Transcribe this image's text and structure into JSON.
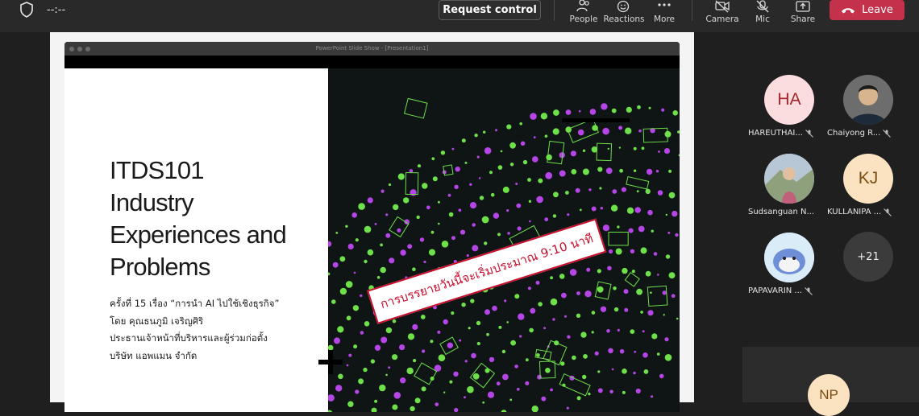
{
  "header": {
    "timer": "--:--",
    "request_control": "Request control",
    "buttons": [
      {
        "label": "People",
        "icon": "people-icon"
      },
      {
        "label": "Reactions",
        "icon": "reactions-icon"
      },
      {
        "label": "More",
        "icon": "more-icon"
      },
      {
        "label": "Camera",
        "icon": "camera-off-icon"
      },
      {
        "label": "Mic",
        "icon": "mic-off-icon"
      },
      {
        "label": "Share",
        "icon": "share-icon"
      }
    ],
    "leave": "Leave"
  },
  "presentation": {
    "window_title": "PowerPoint Slide Show - [Presentation1]",
    "slide_title_lines": [
      "ITDS101",
      "Industry",
      "Experiences and",
      "Problems"
    ],
    "subtitle_lines": [
      "ครั้งที่ 15 เรื่อง “การนำ AI ไปใช้เชิงธุรกิจ”",
      "โดย คุณธนภูมิ เจริญศิริ",
      "ประธานเจ้าหน้าที่บริหารและผู้ร่วมก่อตั้ง",
      "บริษัท แอพแมน จำกัด"
    ],
    "stamp": "การบรรยายวันนี้จะเริ่มประมาณ 9:10 นาที"
  },
  "participants": [
    {
      "initials": "HA",
      "name": "HAREUTHAI...",
      "muted": true,
      "avatar_bg": "#fbdcdf",
      "avatar_fg": "#a4262c"
    },
    {
      "initials": "",
      "name": "Chaiyong R...",
      "muted": true,
      "avatar_bg": "#4a4a4a",
      "avatar_fg": "#ffffff"
    },
    {
      "initials": "",
      "name": "Sudsanguan N...",
      "muted": false,
      "avatar_bg": "#9db3c9",
      "avatar_fg": "#ffffff"
    },
    {
      "initials": "KJ",
      "name": "KULLANIPA ...",
      "muted": true,
      "avatar_bg": "#fbe3c2",
      "avatar_fg": "#7a4d14"
    },
    {
      "initials": "",
      "name": "PAPAVARIN ...",
      "muted": true,
      "avatar_bg": "#cfe7f7",
      "avatar_fg": "#ffffff"
    }
  ],
  "more_count": "+21",
  "featured": {
    "initials": "NP"
  },
  "colors": {
    "leave": "#c4314b",
    "stamp": "#c8102e",
    "dot_green": "#6ee04a",
    "dot_purple": "#b545e6"
  }
}
